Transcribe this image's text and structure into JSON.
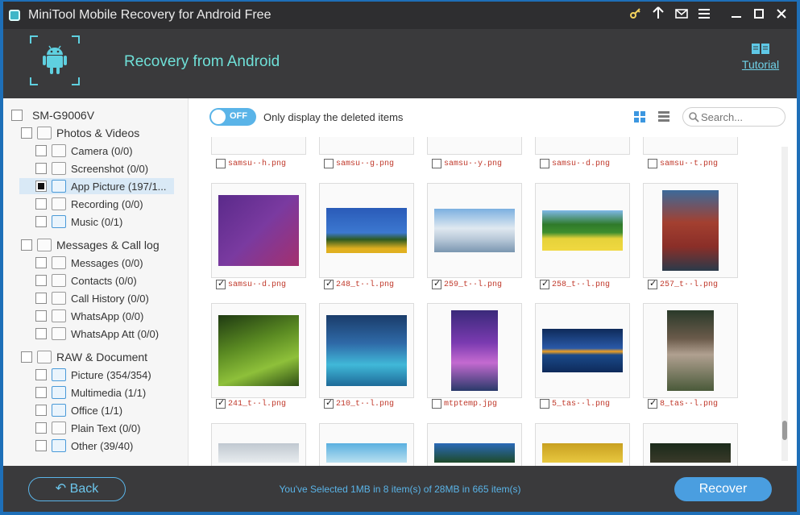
{
  "window": {
    "title": "MiniTool Mobile Recovery for Android Free"
  },
  "header": {
    "title": "Recovery from Android",
    "tutorial_label": "Tutorial"
  },
  "toolbar": {
    "toggle_state": "OFF",
    "only_deleted_label": "Only display the deleted items",
    "search_placeholder": "Search..."
  },
  "tree": {
    "device": "SM-G9006V",
    "groups": [
      {
        "label": "Photos & Videos",
        "items": [
          {
            "label": "Camera (0/0)",
            "icon": "camera-icon"
          },
          {
            "label": "Screenshot (0/0)",
            "icon": "screenshot-icon"
          },
          {
            "label": "App Picture (197/1...",
            "icon": "app-picture-icon",
            "selected": true
          },
          {
            "label": "Recording (0/0)",
            "icon": "recording-icon"
          },
          {
            "label": "Music (0/1)",
            "icon": "music-icon"
          }
        ]
      },
      {
        "label": "Messages & Call log",
        "items": [
          {
            "label": "Messages (0/0)",
            "icon": "messages-icon"
          },
          {
            "label": "Contacts (0/0)",
            "icon": "contacts-icon"
          },
          {
            "label": "Call History (0/0)",
            "icon": "call-history-icon"
          },
          {
            "label": "WhatsApp (0/0)",
            "icon": "whatsapp-icon"
          },
          {
            "label": "WhatsApp Att (0/0)",
            "icon": "whatsapp-attachment-icon"
          }
        ]
      },
      {
        "label": "RAW & Document",
        "items": [
          {
            "label": "Picture (354/354)",
            "icon": "picture-icon"
          },
          {
            "label": "Multimedia (1/1)",
            "icon": "multimedia-icon"
          },
          {
            "label": "Office (1/1)",
            "icon": "office-icon"
          },
          {
            "label": "Plain Text (0/0)",
            "icon": "plain-text-icon"
          },
          {
            "label": "Other (39/40)",
            "icon": "other-icon"
          }
        ]
      }
    ]
  },
  "grid": {
    "rows": [
      [
        {
          "name": "samsu··h.png",
          "checked": false
        },
        {
          "name": "samsu··g.png",
          "checked": false
        },
        {
          "name": "samsu··y.png",
          "checked": false
        },
        {
          "name": "samsu··d.png",
          "checked": false
        },
        {
          "name": "samsu··t.png",
          "checked": false
        }
      ],
      [
        {
          "name": "samsu··d.png",
          "checked": true
        },
        {
          "name": "248_t··l.png",
          "checked": true
        },
        {
          "name": "259_t··l.png",
          "checked": true
        },
        {
          "name": "258_t··l.png",
          "checked": true
        },
        {
          "name": "257_t··l.png",
          "checked": true
        }
      ],
      [
        {
          "name": "241_t··l.png",
          "checked": true
        },
        {
          "name": "210_t··l.png",
          "checked": true
        },
        {
          "name": "mtptemp.jpg",
          "checked": false
        },
        {
          "name": "5_tas··l.png",
          "checked": false
        },
        {
          "name": "8_tas··l.png",
          "checked": true
        }
      ]
    ]
  },
  "footer": {
    "back_label": "Back",
    "status": "You've Selected 1MB in 8 item(s) of 28MB in 665 item(s)",
    "recover_label": "Recover"
  },
  "colors": {
    "accent": "#4a9ee0",
    "header_bg": "#3a3a3c",
    "filename_red": "#c0392b"
  }
}
